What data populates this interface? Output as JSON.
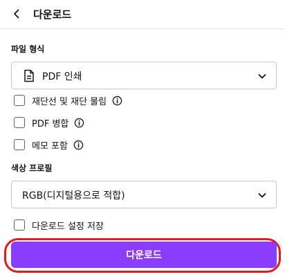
{
  "header": {
    "title": "다운로드",
    "back_icon": "chevron-left-icon"
  },
  "file_type": {
    "label": "파일 형식",
    "selected": "PDF 인쇄",
    "icon": "document-icon"
  },
  "options": [
    {
      "label": "재단선 및 재단 물림",
      "checked": false,
      "info_icon": "info-icon"
    },
    {
      "label": "PDF 병합",
      "checked": false,
      "info_icon": "info-icon"
    },
    {
      "label": "메모 포함",
      "checked": false,
      "info_icon": "info-icon"
    }
  ],
  "color_profile": {
    "label": "색상 프로필",
    "selected": "RGB(디지털용으로 적합)"
  },
  "save_settings": {
    "label": "다운로드 설정 저장",
    "checked": false
  },
  "download_button": {
    "label": "다운로드"
  },
  "colors": {
    "accent": "#8b3dff",
    "highlight_outline": "#e3191b",
    "text": "#0e1318",
    "border": "#c4c9d1"
  }
}
